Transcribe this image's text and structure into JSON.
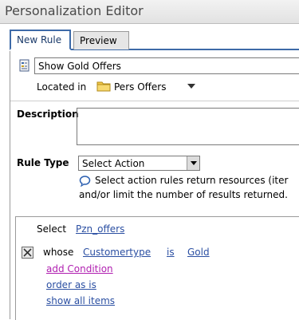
{
  "window": {
    "title": "Personalization Editor"
  },
  "tabs": [
    {
      "label": "New Rule",
      "active": true
    },
    {
      "label": "Preview",
      "active": false
    }
  ],
  "rule": {
    "name_value": "Show Gold Offers",
    "located_label": "Located in",
    "folder": "Pers Offers"
  },
  "description": {
    "label": "Description",
    "value": ""
  },
  "rule_type": {
    "label": "Rule Type",
    "selected": "Select Action",
    "help_line1": "Select action rules return resources (iter",
    "help_line2": "and/or limit the number of results returned."
  },
  "query": {
    "select_label": "Select",
    "resource": "Pzn_offers",
    "whose_label": "whose",
    "attribute": "Customertype",
    "operator": "is",
    "value": "Gold",
    "add_condition": "add Condition",
    "order_as_is": "order as is",
    "show_all_items": "show all items"
  },
  "colors": {
    "accent": "#3d6aa8",
    "link": "#2b4fa2",
    "link_magenta": "#b01fb0"
  },
  "icons": {
    "rule": "rule-document-icon",
    "folder": "folder-icon",
    "dropdown": "chevron-down-icon",
    "help": "speech-bubble-icon",
    "remove": "close-icon"
  }
}
